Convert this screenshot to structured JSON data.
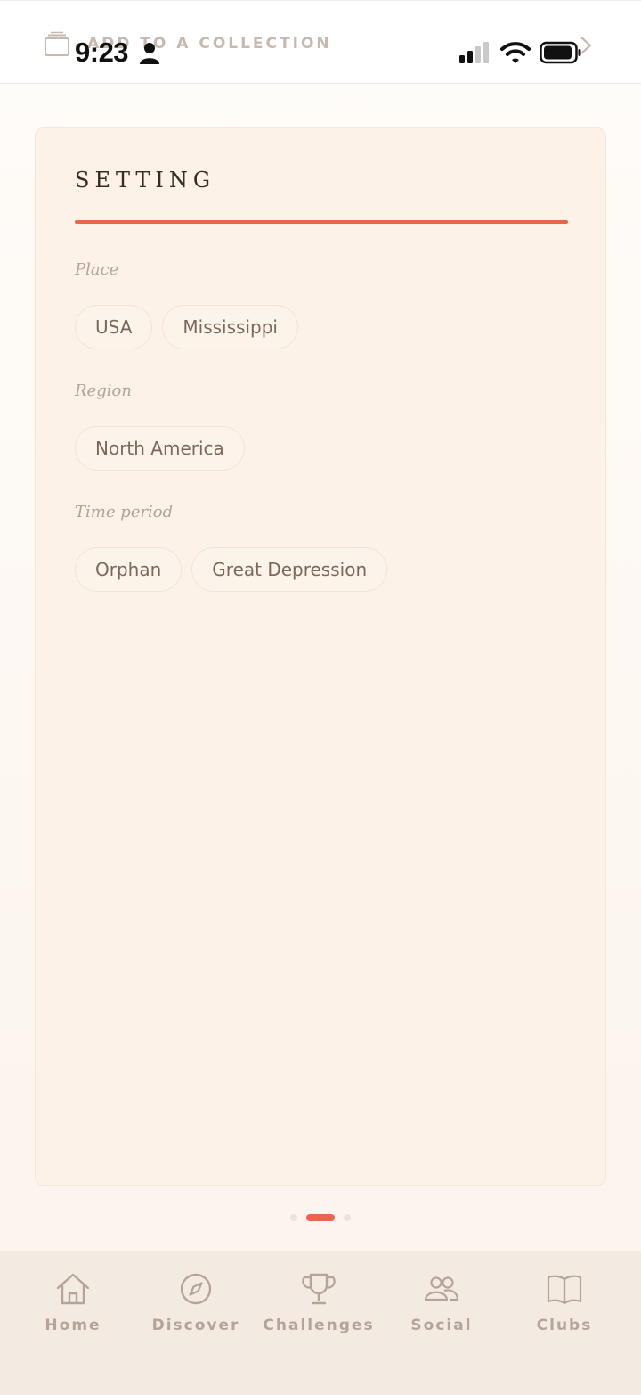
{
  "status_bar": {
    "time": "9:23"
  },
  "header": {
    "collection_label": "ADD TO A COLLECTION",
    "collection_icon": "stack-icon",
    "next_icon": "chevron-right-icon"
  },
  "card": {
    "title": "SETTING",
    "sections": [
      {
        "label": "Place",
        "chips": [
          "USA",
          "Mississippi"
        ]
      },
      {
        "label": "Region",
        "chips": [
          "North America"
        ]
      },
      {
        "label": "Time period",
        "chips": [
          "Orphan",
          "Great Depression"
        ]
      }
    ]
  },
  "pager": {
    "count": 3,
    "active_index": 1
  },
  "bottom_nav": {
    "items": [
      {
        "label": "Home",
        "icon": "home-icon"
      },
      {
        "label": "Discover",
        "icon": "compass-icon"
      },
      {
        "label": "Challenges",
        "icon": "trophy-icon"
      },
      {
        "label": "Social",
        "icon": "people-icon"
      },
      {
        "label": "Clubs",
        "icon": "book-icon"
      }
    ]
  },
  "colors": {
    "accent": "#e8674a",
    "card_bg": "#fcf2e8",
    "nav_bg": "#f3ebe2",
    "muted_text": "#b6a499"
  }
}
